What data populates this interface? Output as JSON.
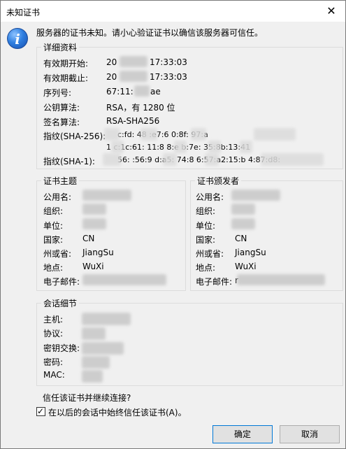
{
  "window": {
    "title": "未知证书",
    "close_glyph": "✕"
  },
  "message": "服务器的证书未知。请小心验证证书以确信该服务器可信任。",
  "details": {
    "legend": "详细资料",
    "rows": [
      {
        "label": "有效期开始:",
        "value": "20",
        "value2": "17:33:03"
      },
      {
        "label": "有效期截止:",
        "value": "20",
        "value2": "17:33:03"
      },
      {
        "label": "序列号:",
        "value": "67:11:",
        "value2": "ae"
      },
      {
        "label": "公钥算法:",
        "value": "RSA，有 1280 位"
      },
      {
        "label": "签名算法:",
        "value": "RSA-SHA256"
      },
      {
        "label": "指纹(SHA-256):",
        "value": "c:fd:   48   :e7:6   0:8f:   97:a",
        "value2": "1   c:1c:61:   11:8   8:e   b:7e:   35:8b:13:41"
      },
      {
        "label": "指纹(SHA-1):",
        "value": "56:   :56:9   d:a5:   74:8   6:57:a2:15:b   4:87:d8:"
      }
    ]
  },
  "subject": {
    "legend": "证书主题",
    "rows": [
      {
        "label": "公用名:",
        "value": ""
      },
      {
        "label": "组织:",
        "value": ""
      },
      {
        "label": "单位:",
        "value": ""
      },
      {
        "label": "国家:",
        "value": "CN"
      },
      {
        "label": "州或省:",
        "value": "JiangSu"
      },
      {
        "label": "地点:",
        "value": "WuXi"
      },
      {
        "label": "电子邮件:",
        "value": ""
      }
    ]
  },
  "issuer": {
    "legend": "证书颁发者",
    "rows": [
      {
        "label": "公用名:",
        "value": ""
      },
      {
        "label": "组织:",
        "value": ""
      },
      {
        "label": "单位:",
        "value": ""
      },
      {
        "label": "国家:",
        "value": "CN"
      },
      {
        "label": "州或省:",
        "value": "JiangSu"
      },
      {
        "label": "地点:",
        "value": "WuXi"
      },
      {
        "label": "电子邮件:",
        "value": "r"
      }
    ]
  },
  "session": {
    "legend": "会话细节",
    "rows": [
      {
        "label": "主机:"
      },
      {
        "label": "协议:"
      },
      {
        "label": "密钥交换:"
      },
      {
        "label": "密码:"
      },
      {
        "label": "MAC:"
      }
    ]
  },
  "question": "信任该证书并继续连接?",
  "always_trust": {
    "label": "在以后的会话中始终信任该证书(A)。",
    "checked": true,
    "mark": "✓"
  },
  "buttons": {
    "ok": "确定",
    "cancel": "取消"
  },
  "icons": {
    "info": "info-icon",
    "close": "close-icon",
    "check": "checkmark-icon"
  }
}
